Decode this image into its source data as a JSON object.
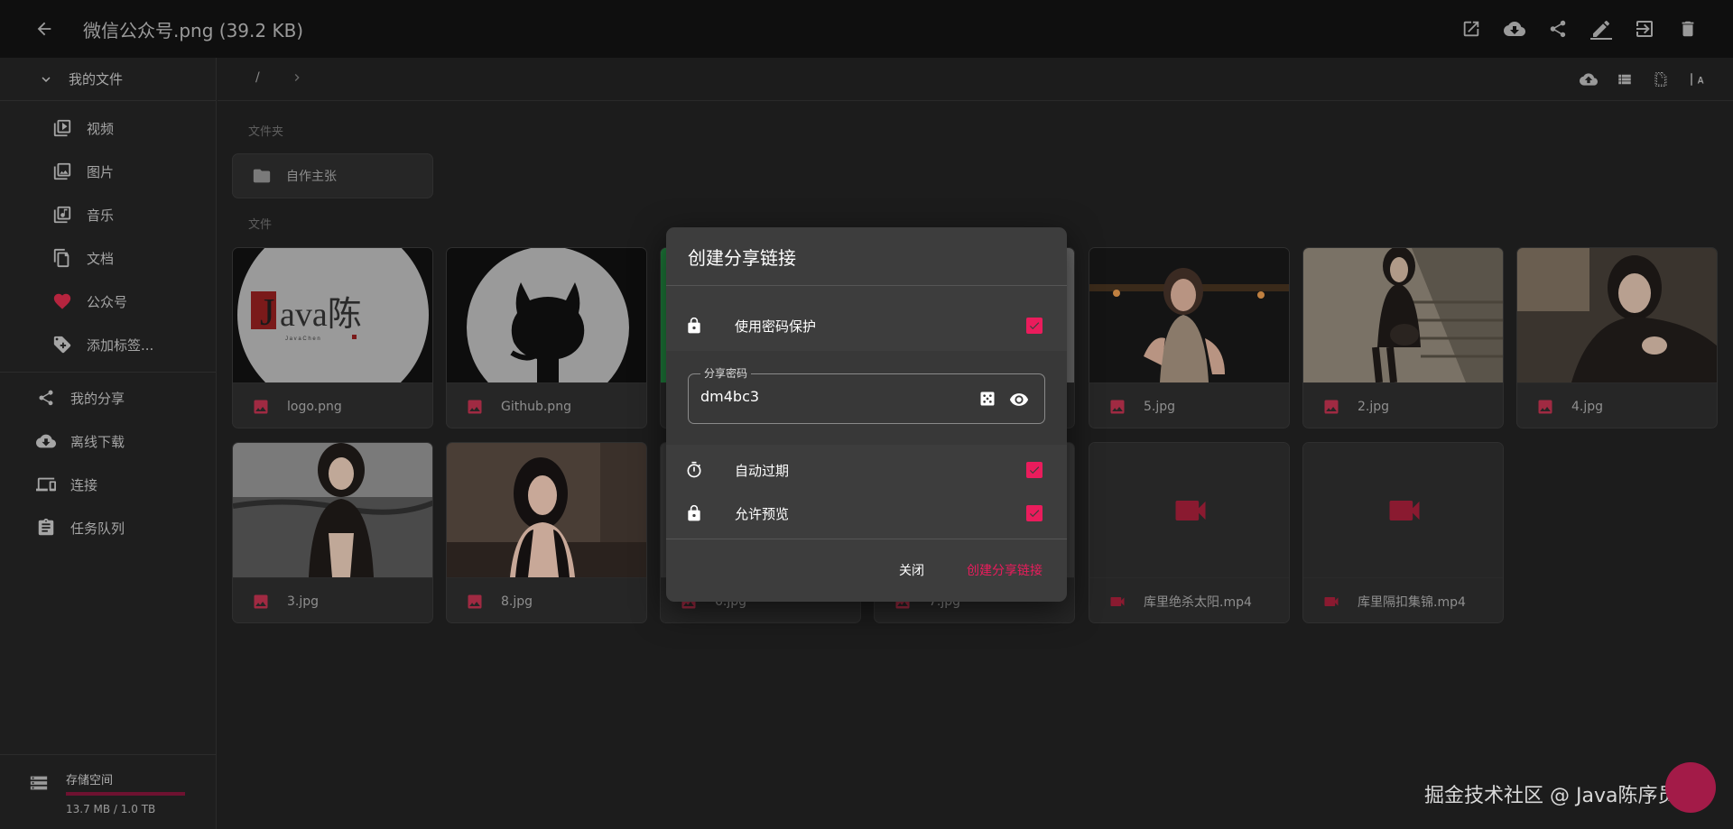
{
  "topbar": {
    "title": "微信公众号.png (39.2 KB)",
    "actions": [
      "open-external-icon",
      "download-icon",
      "share-icon",
      "edit-icon",
      "move-icon",
      "delete-icon"
    ]
  },
  "sidebar": {
    "my_files_label": "我的文件",
    "sub_items": [
      {
        "label": "视频",
        "icon": "video-library-icon"
      },
      {
        "label": "图片",
        "icon": "image-library-icon"
      },
      {
        "label": "音乐",
        "icon": "music-library-icon"
      },
      {
        "label": "文档",
        "icon": "documents-icon"
      },
      {
        "label": "公众号",
        "icon": "heart-icon"
      },
      {
        "label": "添加标签...",
        "icon": "add-tag-icon"
      }
    ],
    "top_items": [
      {
        "label": "我的分享",
        "icon": "share-icon"
      },
      {
        "label": "离线下载",
        "icon": "cloud-download-icon"
      },
      {
        "label": "连接",
        "icon": "devices-icon"
      },
      {
        "label": "任务队列",
        "icon": "task-queue-icon"
      }
    ],
    "storage": {
      "title": "存储空间",
      "value": "13.7 MB / 1.0 TB",
      "used_fraction": 1.37e-05
    }
  },
  "breadcrumb": {
    "root": "/"
  },
  "sections": {
    "folders": "文件夹",
    "files": "文件"
  },
  "folders": [
    {
      "name": "自作主张"
    }
  ],
  "files": [
    {
      "name": "logo.png",
      "type": "image",
      "thumb": "logo"
    },
    {
      "name": "Github.png",
      "type": "image",
      "thumb": "github"
    },
    {
      "name": "",
      "type": "image",
      "thumb": "qr"
    },
    {
      "name": "",
      "type": "image",
      "thumb": "photo-light"
    },
    {
      "name": "5.jpg",
      "type": "image",
      "thumb": "photo-night"
    },
    {
      "name": "2.jpg",
      "type": "image",
      "thumb": "photo-stairs"
    },
    {
      "name": "4.jpg",
      "type": "image",
      "thumb": "photo-dark"
    },
    {
      "name": "3.jpg",
      "type": "image",
      "thumb": "photo-city"
    },
    {
      "name": "8.jpg",
      "type": "image",
      "thumb": "photo-room"
    },
    {
      "name": "6.jpg",
      "type": "image",
      "thumb": "photo-gray"
    },
    {
      "name": "7.jpg",
      "type": "image",
      "thumb": "photo-gray2"
    },
    {
      "name": "库里绝杀太阳.mp4",
      "type": "video",
      "thumb": "video"
    },
    {
      "name": "库里隔扣集锦.mp4",
      "type": "video",
      "thumb": "video"
    }
  ],
  "dialog": {
    "title": "创建分享链接",
    "password_protect_label": "使用密码保护",
    "password_protect_checked": true,
    "password_field_label": "分享密码",
    "password_value": "dm4bc3",
    "auto_expire_label": "自动过期",
    "auto_expire_checked": true,
    "allow_preview_label": "允许预览",
    "allow_preview_checked": true,
    "close_button": "关闭",
    "create_button": "创建分享链接"
  },
  "watermark": "掘金技术社区 @ Java陈序员",
  "colors": {
    "accent": "#ea1c5c",
    "file_icon": "#b5304b",
    "background": "#1c1c1c"
  }
}
